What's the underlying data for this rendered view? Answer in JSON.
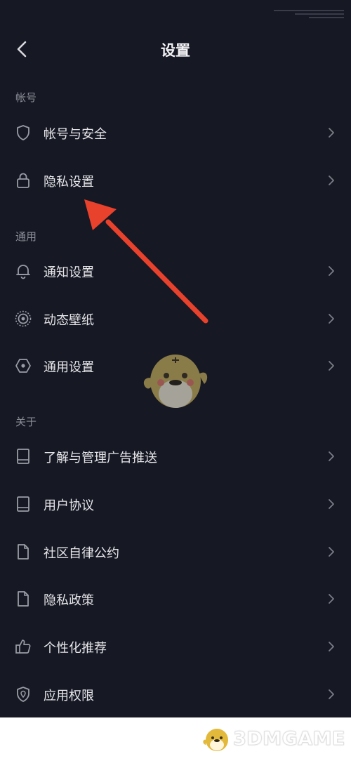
{
  "header": {
    "title": "设置"
  },
  "sections": [
    {
      "label": "帐号",
      "items": [
        {
          "label": "帐号与安全",
          "icon": "shield-icon"
        },
        {
          "label": "隐私设置",
          "icon": "lock-icon"
        }
      ]
    },
    {
      "label": "通用",
      "items": [
        {
          "label": "通知设置",
          "icon": "bell-icon"
        },
        {
          "label": "动态壁纸",
          "icon": "live-wallpaper-icon"
        },
        {
          "label": "通用设置",
          "icon": "hexagon-settings-icon"
        }
      ]
    },
    {
      "label": "关于",
      "items": [
        {
          "label": "了解与管理广告推送",
          "icon": "book-icon"
        },
        {
          "label": "用户协议",
          "icon": "book-icon"
        },
        {
          "label": "社区自律公约",
          "icon": "document-icon"
        },
        {
          "label": "隐私政策",
          "icon": "document-icon"
        },
        {
          "label": "个性化推荐",
          "icon": "thumbs-up-icon"
        },
        {
          "label": "应用权限",
          "icon": "shield-location-icon"
        }
      ]
    }
  ],
  "watermark": {
    "text": "3DMGAME"
  },
  "colors": {
    "background": "#161823",
    "text": "#e6e6ea",
    "section": "#8a8c96",
    "accent_arrow": "#e8412c",
    "icon": "#9a9ca6"
  }
}
